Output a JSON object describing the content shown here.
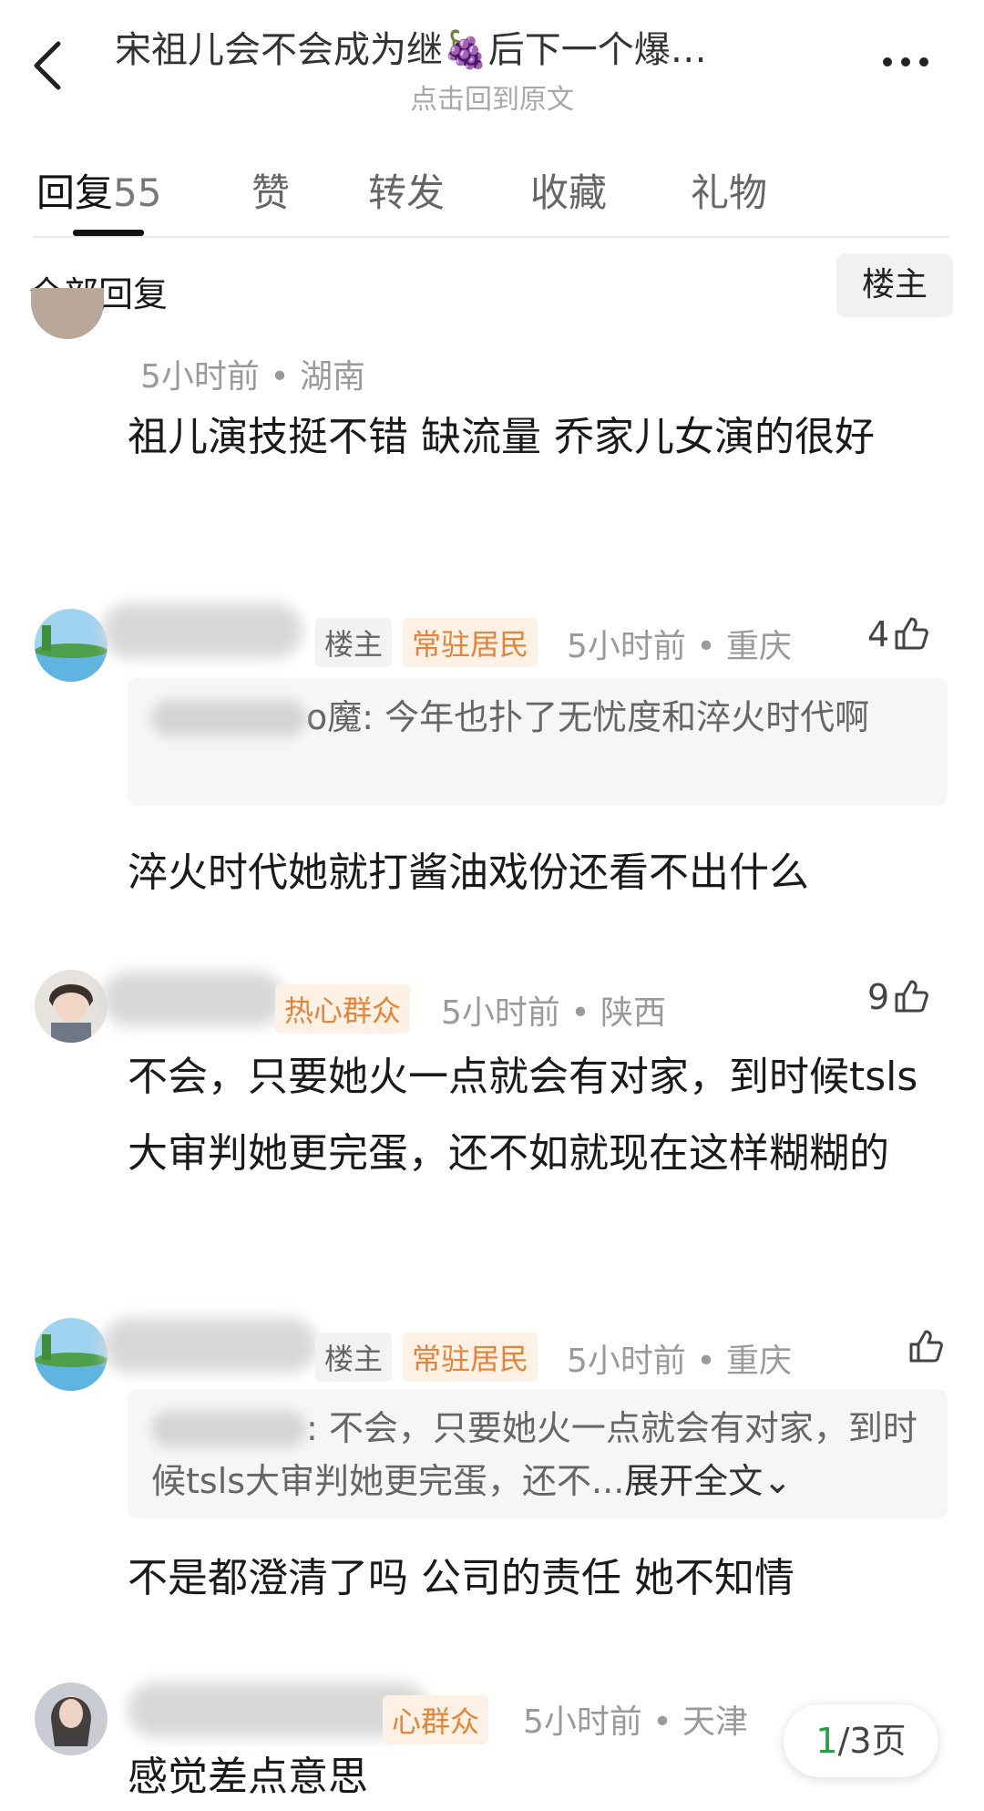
{
  "header": {
    "title": "宋祖儿会不会成为继🍇后下一个爆…",
    "subtitle": "点击回到原文"
  },
  "tabs": [
    {
      "label": "回复",
      "count": "55"
    },
    {
      "label": "赞"
    },
    {
      "label": "转发"
    },
    {
      "label": "收藏"
    },
    {
      "label": "礼物"
    }
  ],
  "section": {
    "title": "全部回复",
    "owner_filter": "楼主"
  },
  "comments": [
    {
      "time_location": "5小时前 • 湖南",
      "text": "祖儿演技挺不错 缺流量 乔家儿女演的很好"
    },
    {
      "badges": [
        "楼主",
        "常驻居民"
      ],
      "time_location": "5小时前 • 重庆",
      "likes": "4",
      "quote_author_suffix": "o魔:",
      "quote_text": "今年也扑了无忧度和淬火时代啊",
      "text": "淬火时代她就打酱油戏份还看不出什么"
    },
    {
      "badges": [
        "热心群众"
      ],
      "time_location": "5小时前 • 陕西",
      "likes": "9",
      "text": "不会，只要她火一点就会有对家，到时候tsls大审判她更完蛋，还不如就现在这样糊糊的"
    },
    {
      "badges": [
        "楼主",
        "常驻居民"
      ],
      "time_location": "5小时前 • 重庆",
      "quote_text": ": 不会，只要她火一点就会有对家，到时候tsls大审判她更完蛋，还不...",
      "quote_expand": "展开全文",
      "text": "不是都澄清了吗 公司的责任 她不知情"
    },
    {
      "badges": [
        "心群众"
      ],
      "time_location": "5小时前 • 天津",
      "text": "感觉差点意思"
    }
  ],
  "pager": {
    "current": "1",
    "total": "/3页"
  }
}
